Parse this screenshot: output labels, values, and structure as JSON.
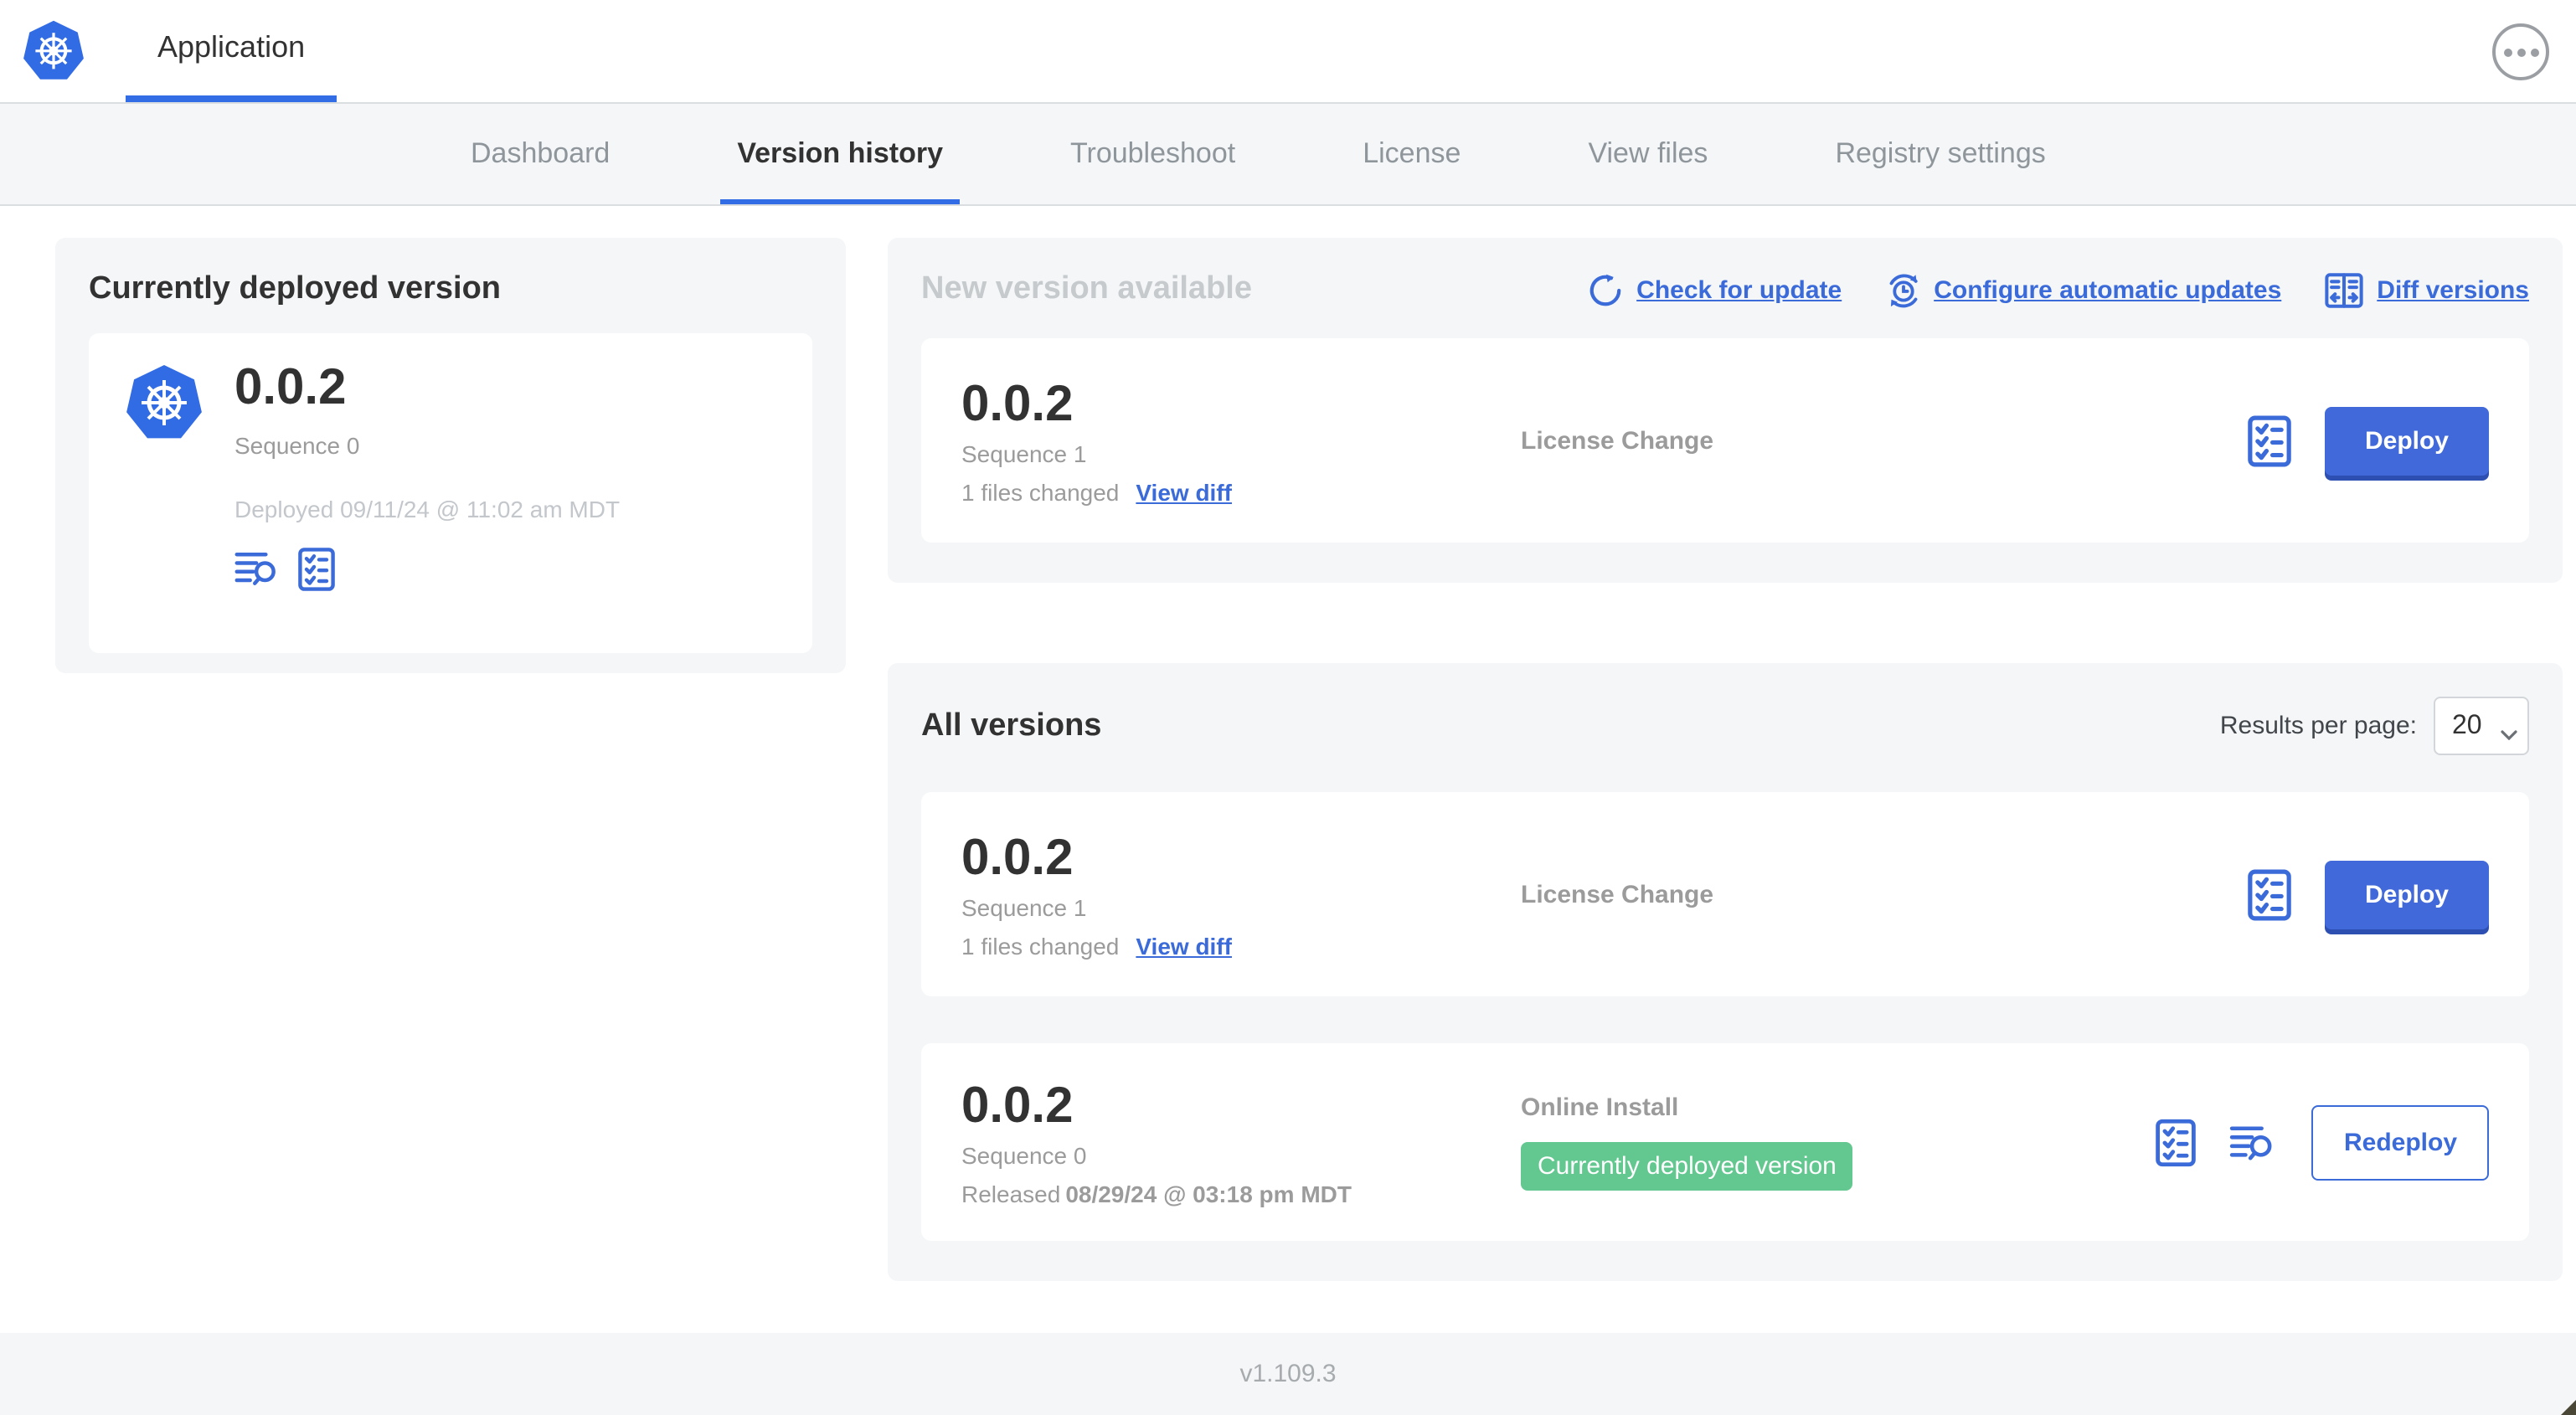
{
  "header": {
    "app_tab_label": "Application"
  },
  "nav": {
    "tabs": [
      {
        "label": "Dashboard",
        "active": false
      },
      {
        "label": "Version history",
        "active": true
      },
      {
        "label": "Troubleshoot",
        "active": false
      },
      {
        "label": "License",
        "active": false
      },
      {
        "label": "View files",
        "active": false
      },
      {
        "label": "Registry settings",
        "active": false
      }
    ]
  },
  "current_version_panel": {
    "title": "Currently deployed version",
    "version": "0.0.2",
    "sequence": "Sequence 0",
    "deployed_at": "Deployed 09/11/24 @ 11:02 am MDT"
  },
  "new_version_panel": {
    "title": "New version available",
    "actions": [
      {
        "label": "Check for update",
        "icon": "refresh-icon"
      },
      {
        "label": "Configure automatic updates",
        "icon": "clock-refresh-icon"
      },
      {
        "label": "Diff versions",
        "icon": "diff-icon"
      }
    ],
    "card": {
      "version": "0.0.2",
      "sequence": "Sequence 1",
      "files_changed": "1 files changed",
      "view_diff_label": "View diff",
      "source": "License Change",
      "deploy_label": "Deploy"
    }
  },
  "all_versions_panel": {
    "title": "All versions",
    "results_per_page_label": "Results per page:",
    "results_per_page_value": "20",
    "rows": [
      {
        "version": "0.0.2",
        "sequence": "Sequence 1",
        "files_changed": "1 files changed",
        "view_diff_label": "View diff",
        "source": "License Change",
        "action_label": "Deploy"
      },
      {
        "version": "0.0.2",
        "sequence": "Sequence 0",
        "released_prefix": "Released",
        "released_date": "08/29/24 @ 03:18 pm MDT",
        "source": "Online Install",
        "badge": "Currently deployed version",
        "action_label": "Redeploy"
      }
    ]
  },
  "footer": {
    "version": "v1.109.3"
  },
  "icons": [
    "kubernetes-logo",
    "ellipsis-icon",
    "refresh-icon",
    "clock-refresh-icon",
    "diff-icon",
    "checklist-icon",
    "logs-icon",
    "chevron-down-icon"
  ],
  "colors": {
    "primary_blue": "#3B6AD9",
    "kubernetes_blue": "#326CE5",
    "badge_green": "#63C790",
    "panel_gray": "#F4F6F8",
    "text_dark": "#323232",
    "text_gray": "#9B9B9B",
    "text_light": "#C6CACD"
  }
}
